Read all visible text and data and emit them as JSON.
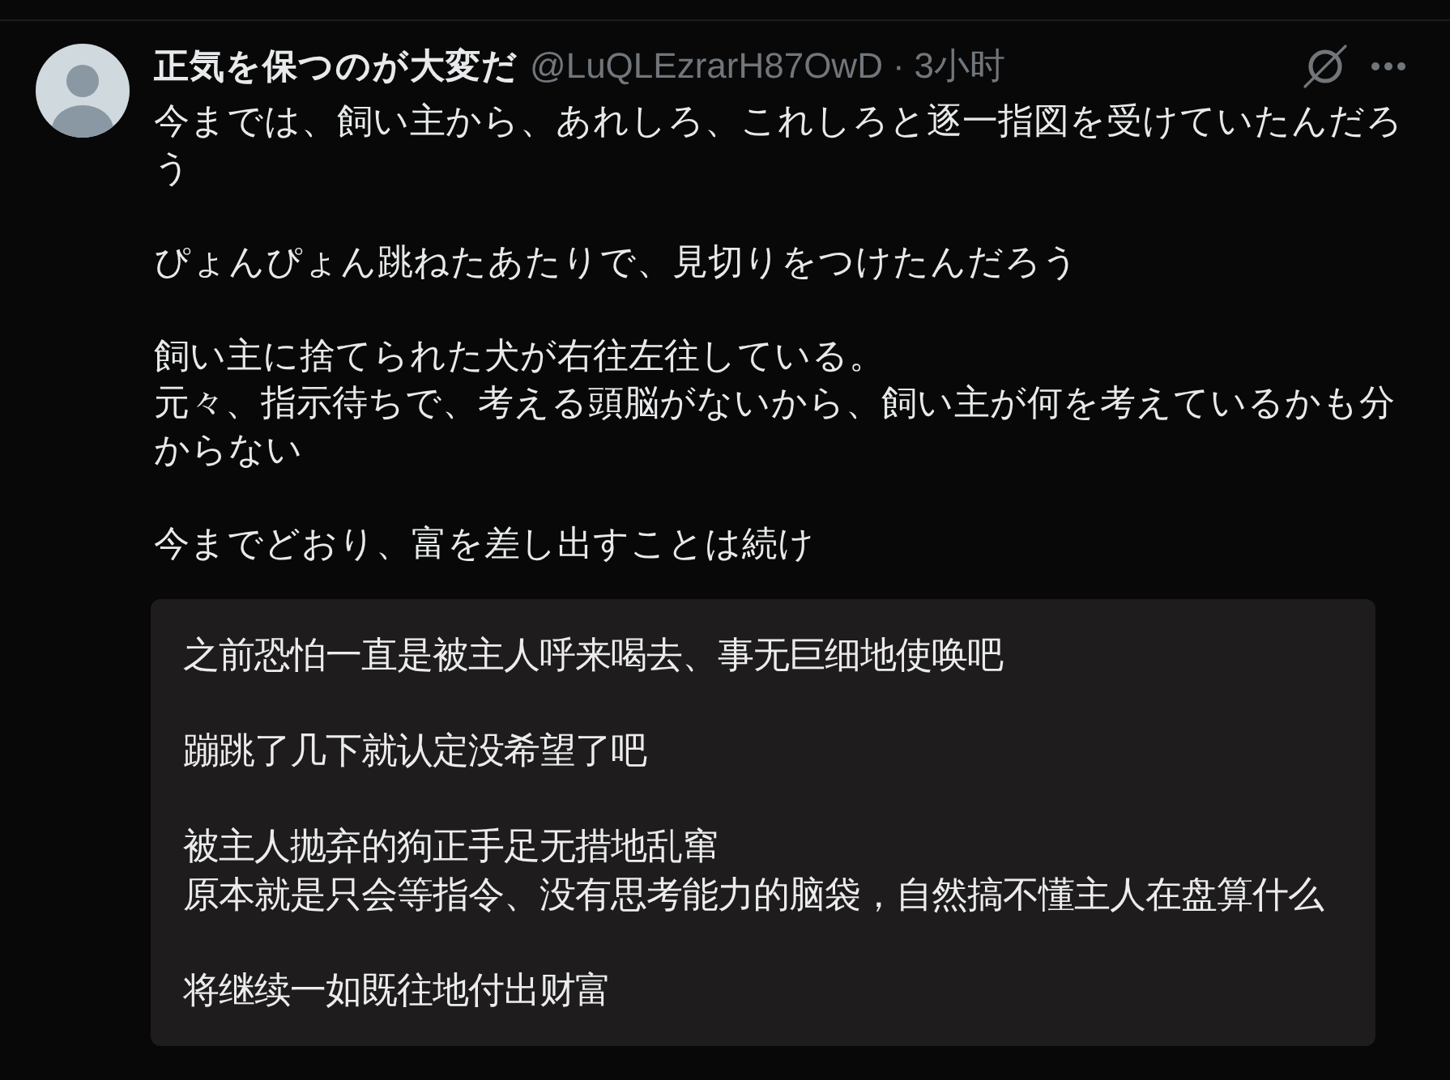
{
  "post": {
    "author": {
      "name": "正気を保つのが大変だ",
      "handle": "@LuQLEzrarH87OwD",
      "separator": "·",
      "time": "3小时"
    },
    "body": [
      [
        "今までは、飼い主から、あれしろ、これしろと逐一指図を受けていたんだろう"
      ],
      [
        "ぴょんぴょん跳ねたあたりで、見切りをつけたんだろう"
      ],
      [
        "飼い主に捨てられた犬が右往左往している。",
        "元々、指示待ちで、考える頭脳がないから、飼い主が何を考えているかも分からない"
      ],
      [
        "今までどおり、富を差し出すことは続け"
      ]
    ],
    "translation": {
      "paragraphs": [
        [
          "之前恐怕一直是被主人呼来喝去、事无巨细地使唤吧"
        ],
        [
          "蹦跳了几下就认定没希望了吧"
        ],
        [
          "被主人抛弃的狗正手足无措地乱窜",
          "原本就是只会等指令、没有思考能力的脑袋，自然搞不懂主人在盘算什么"
        ],
        [
          "将继续一如既往地付出财富"
        ]
      ]
    }
  }
}
